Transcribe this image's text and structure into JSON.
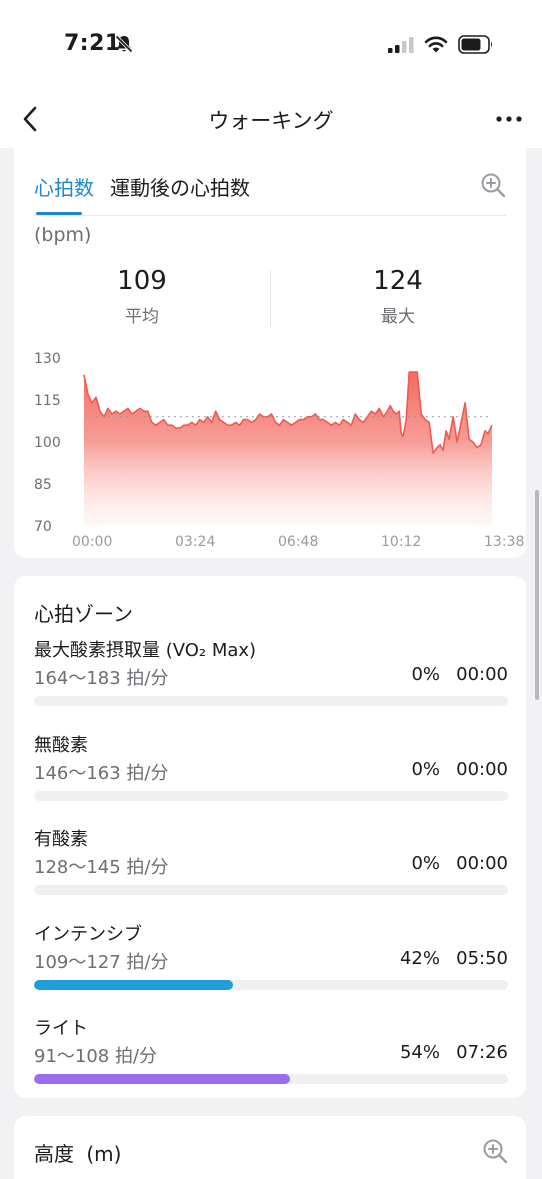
{
  "status": {
    "time": "7:21"
  },
  "nav": {
    "title": "ウォーキング"
  },
  "heart_rate": {
    "tabs": [
      {
        "label": "心拍数",
        "active": true
      },
      {
        "label": "運動後の心拍数",
        "active": false
      }
    ],
    "unit": "(bpm)",
    "average": {
      "value": "109",
      "label": "平均"
    },
    "max": {
      "value": "124",
      "label": "最大"
    }
  },
  "chart_data": {
    "type": "area",
    "ylim": [
      70,
      130
    ],
    "yticks": [
      130,
      115,
      100,
      85,
      70
    ],
    "xtick_labels": [
      "00:00",
      "03:24",
      "06:48",
      "10:12",
      "13:38"
    ],
    "reference_line": 109,
    "x_seconds_max": 818,
    "series": [
      {
        "x_seconds": [
          0,
          8,
          16,
          24,
          32,
          40,
          48,
          56,
          64,
          72,
          80,
          88,
          96,
          104,
          112,
          120,
          128,
          136,
          144,
          152,
          160,
          168,
          176,
          184,
          192,
          200,
          208,
          216,
          224,
          232,
          240,
          248,
          256,
          264,
          272,
          280,
          288,
          296,
          304,
          312,
          320,
          328,
          336,
          344,
          352,
          360,
          368,
          376,
          384,
          392,
          400,
          408,
          416,
          424,
          432,
          440,
          448,
          456,
          464,
          472,
          480,
          488,
          496,
          504,
          512,
          520,
          528,
          536,
          544,
          552,
          560,
          568,
          576,
          584,
          592,
          600,
          608,
          614,
          620,
          626,
          632,
          636,
          640,
          646,
          652,
          660,
          668,
          676,
          684,
          692,
          700,
          708,
          714,
          720,
          726,
          732,
          740,
          748,
          756,
          764,
          772,
          780,
          788,
          796,
          804,
          810,
          818
        ],
        "values": [
          124,
          117,
          114,
          116,
          111,
          109,
          112,
          110,
          111,
          110,
          111,
          112,
          110,
          111,
          112,
          111,
          111,
          107,
          106,
          107,
          108,
          106,
          106,
          105,
          105,
          106,
          106,
          107,
          106,
          108,
          107,
          109,
          107,
          111,
          108,
          107,
          106,
          106,
          107,
          106,
          108,
          108,
          107,
          108,
          110,
          109,
          109,
          110,
          107,
          106,
          108,
          107,
          106,
          107,
          108,
          108,
          109,
          109,
          110,
          108,
          108,
          107,
          106,
          107,
          106,
          108,
          107,
          106,
          110,
          108,
          107,
          109,
          111,
          110,
          112,
          109,
          111,
          113,
          111,
          110,
          111,
          103,
          102,
          108,
          125,
          125,
          125,
          110,
          108,
          107,
          96,
          98,
          99,
          97,
          104,
          101,
          109,
          100,
          107,
          114,
          101,
          100,
          98,
          99,
          104,
          103,
          106,
          102,
          97
        ]
      }
    ]
  },
  "zones": {
    "title": "心拍ゾーン",
    "items": [
      {
        "name": "最大酸素摂取量 (VO₂ Max)",
        "range": "164〜183 拍/分",
        "percent": "0%",
        "time": "00:00",
        "fill_fraction": 0,
        "color": "#e5e5e7"
      },
      {
        "name": "無酸素",
        "range": "146〜163 拍/分",
        "percent": "0%",
        "time": "00:00",
        "fill_fraction": 0,
        "color": "#e5e5e7"
      },
      {
        "name": "有酸素",
        "range": "128〜145 拍/分",
        "percent": "0%",
        "time": "00:00",
        "fill_fraction": 0,
        "color": "#e5e5e7"
      },
      {
        "name": "インテンシブ",
        "range": "109〜127 拍/分",
        "percent": "42%",
        "time": "05:50",
        "fill_fraction": 0.42,
        "color": "#1e9fd8"
      },
      {
        "name": "ライト",
        "range": "91〜108 拍/分",
        "percent": "54%",
        "time": "07:26",
        "fill_fraction": 0.54,
        "color": "#9b6cf0"
      }
    ]
  },
  "altitude": {
    "title": "高度",
    "unit": "(m)"
  },
  "colors": {
    "accent": "#1e88c8",
    "chart_line": "#f05a50",
    "chart_fill_top": "#f36b63"
  }
}
